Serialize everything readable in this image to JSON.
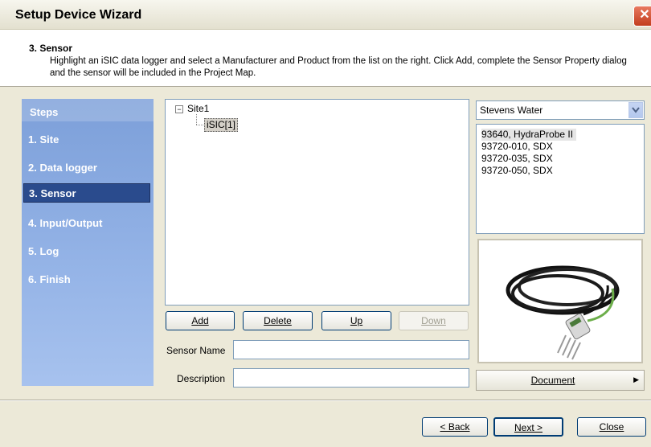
{
  "window": {
    "title": "Setup Device Wizard",
    "close_glyph": "✕"
  },
  "header": {
    "title": "3. Sensor",
    "description": "Highlight an iSIC data logger and select a Manufacturer and Product from the list on the right. Click Add, complete the Sensor Property dialog and the sensor will be included in the Project Map."
  },
  "steps": {
    "title": "Steps",
    "items": [
      "1. Site",
      "2. Data logger",
      "3. Sensor",
      "4. Input/Output",
      "5. Log",
      "6. Finish"
    ],
    "active_index": 2
  },
  "tree": {
    "root": "Site1",
    "expander": "−",
    "child": "iSIC[1]"
  },
  "tree_buttons": {
    "add": "Add",
    "delete": "Delete",
    "up": "Up",
    "down": "Down"
  },
  "form": {
    "sensor_name_label": "Sensor Name",
    "sensor_name_value": "",
    "description_label": "Description",
    "description_value": ""
  },
  "manufacturer": {
    "selected": "Stevens Water",
    "arrow_icon": "chevron-down-icon"
  },
  "products": [
    "93640, HydraProbe II",
    "93720-010, SDX",
    "93720-035, SDX",
    "93720-050, SDX"
  ],
  "document_button": {
    "label": "Document",
    "arrow": "▶"
  },
  "footer": {
    "back": "< Back",
    "next": "Next >",
    "close": "Close"
  },
  "colors": {
    "steps_panel": "#7c9fd9",
    "active_step": "#2a4b8d",
    "button_border": "#003c74",
    "sensor_cable": "#6cae4a"
  }
}
